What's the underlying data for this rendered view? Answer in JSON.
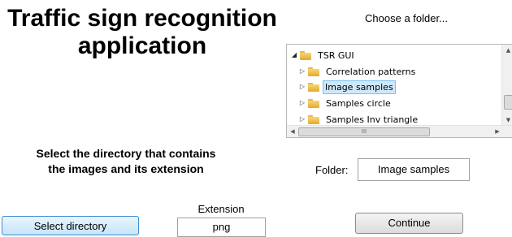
{
  "title": {
    "line1": "Traffic sign recognition",
    "line2": "application"
  },
  "folder_chooser": {
    "prompt": "Choose a folder...",
    "tree": {
      "root": {
        "label": "TSR GUI",
        "expander": "◢",
        "icon": "folder-icon"
      },
      "children": [
        {
          "label": "Correlation patterns",
          "expander": "▷",
          "icon": "folder-icon",
          "selected": false
        },
        {
          "label": "Image samples",
          "expander": "▷",
          "icon": "folder-icon",
          "selected": true
        },
        {
          "label": "Samples circle",
          "expander": "▷",
          "icon": "folder-icon",
          "selected": false
        },
        {
          "label": "Samples Inv triangle",
          "expander": "▷",
          "icon": "folder-icon",
          "selected": false
        }
      ]
    },
    "scroll": {
      "up": "▲",
      "down": "▼",
      "left": "◀",
      "right": "▶",
      "grip": "III"
    }
  },
  "instructions": {
    "line1": "Select the directory that contains",
    "line2": "the images and its extension"
  },
  "folder": {
    "label": "Folder:",
    "value": "Image samples"
  },
  "extension": {
    "label": "Extension",
    "value": "png"
  },
  "buttons": {
    "select_directory": "Select directory",
    "continue": "Continue"
  },
  "colors": {
    "selection_fill": "#cde8fb",
    "selection_border": "#7ec0ee",
    "select_button_border": "#3c8cd4",
    "folder_icon": "#e9b744"
  }
}
